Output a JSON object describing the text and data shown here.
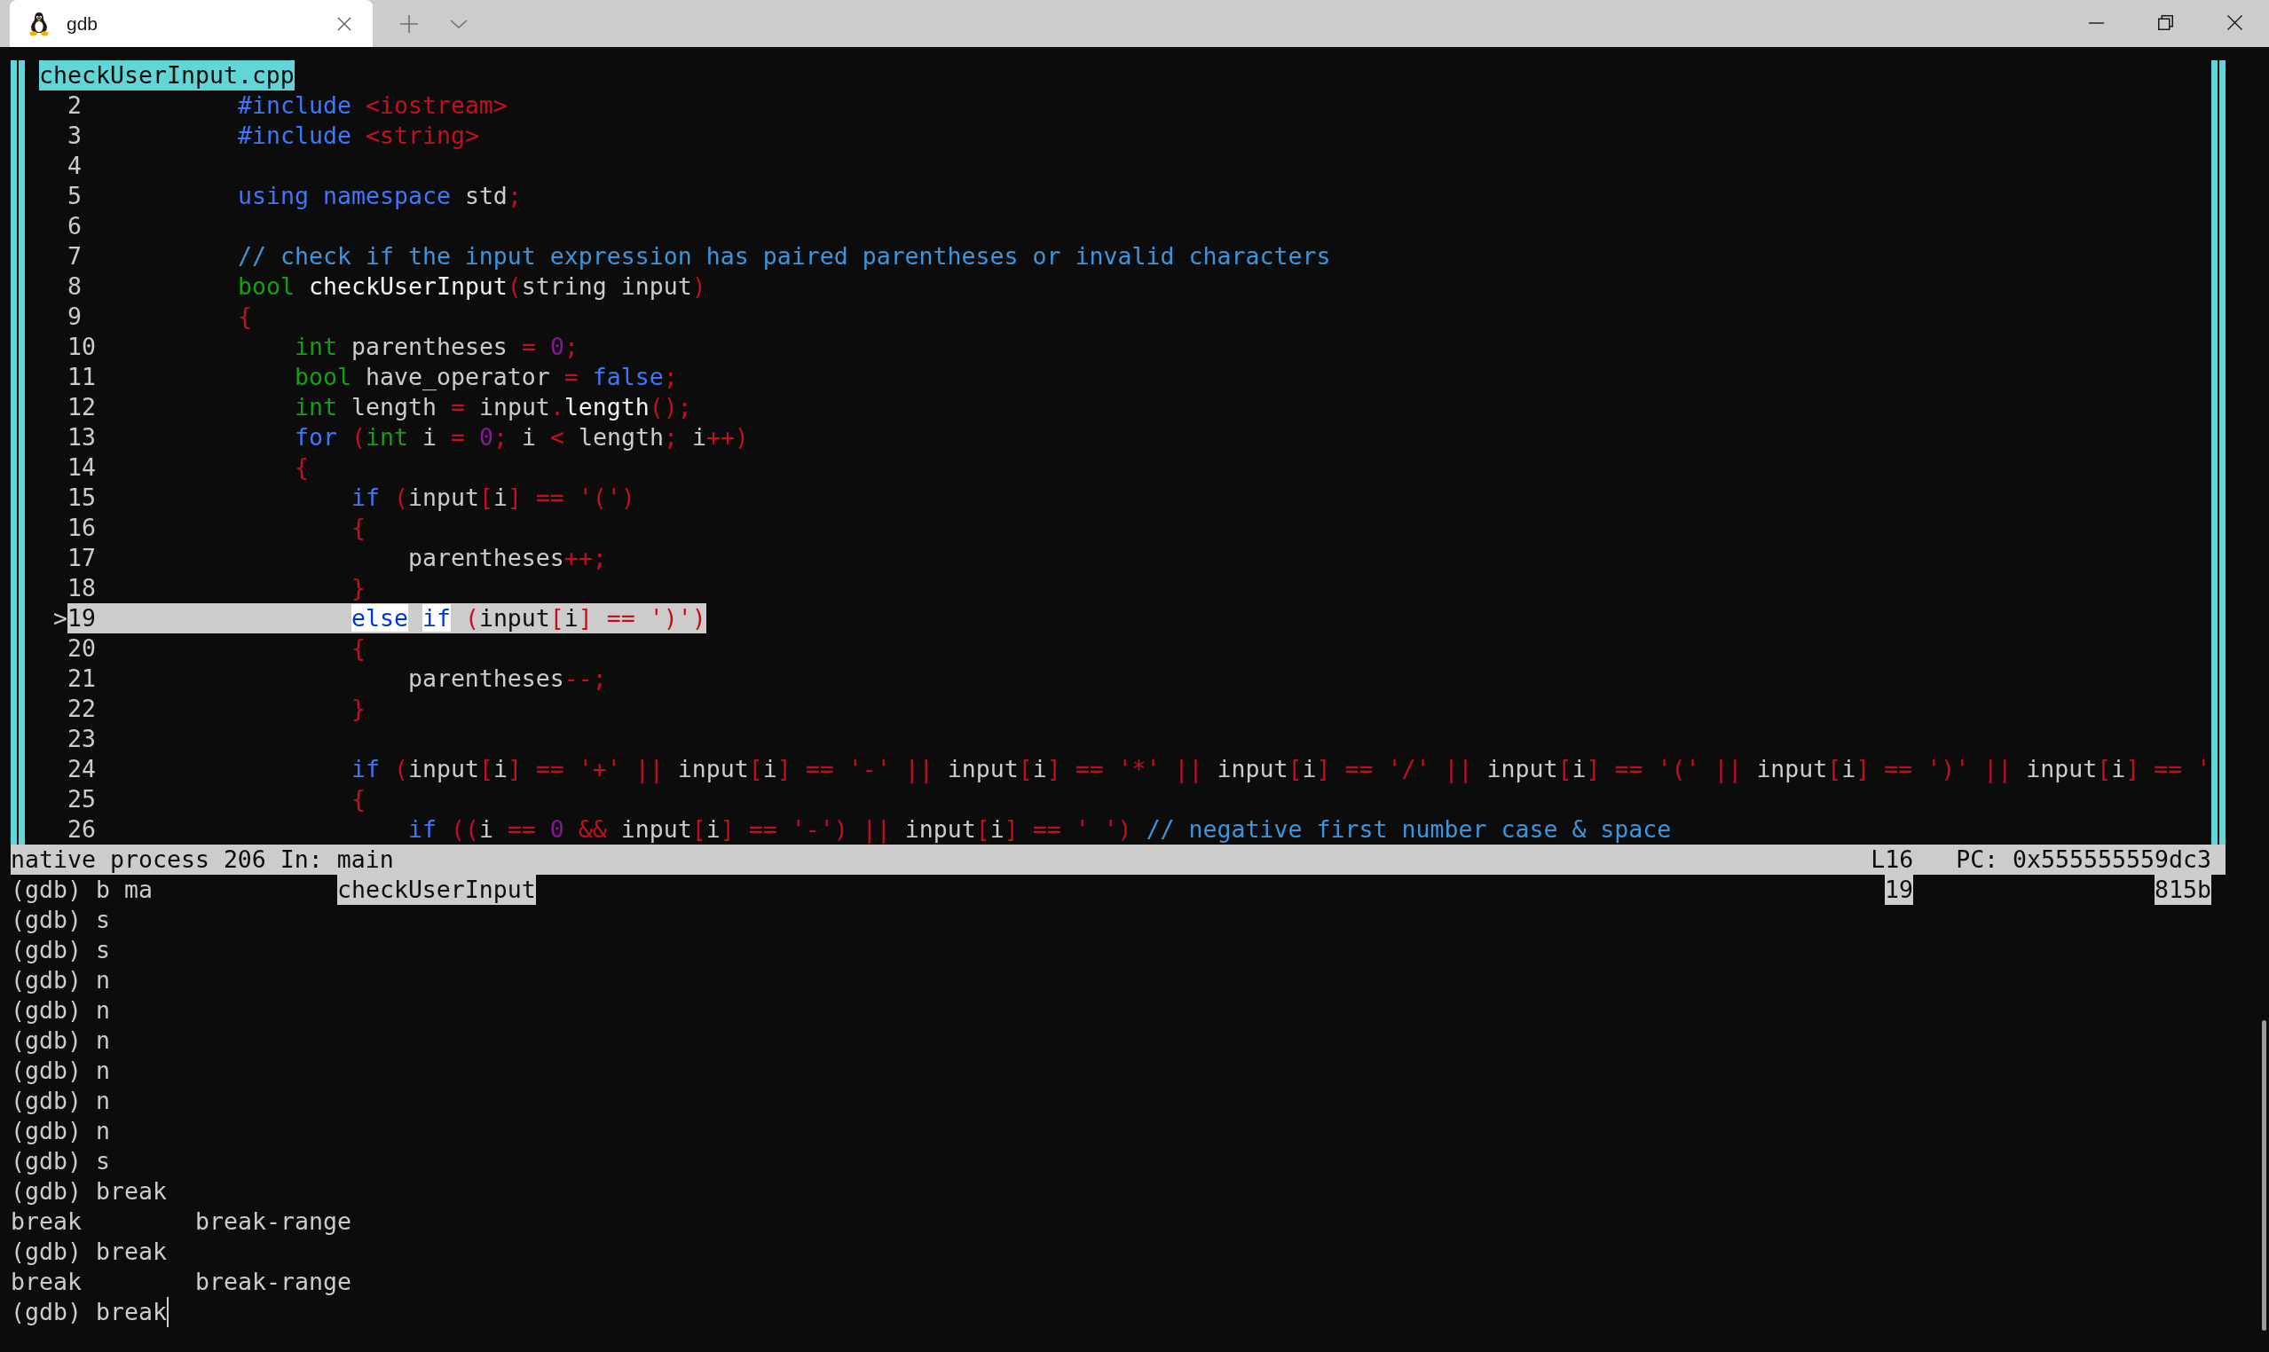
{
  "window": {
    "tabs": [
      {
        "title": "gdb",
        "selected": true
      }
    ]
  },
  "source": {
    "file": "checkUserInput.cpp",
    "lines": [
      {
        "number": "2",
        "current": false,
        "tokens": [
          {
            "kind": "keyword",
            "text": "#include"
          },
          {
            "kind": "string",
            "text": " <iostream>"
          }
        ]
      },
      {
        "number": "3",
        "current": false,
        "tokens": [
          {
            "kind": "keyword",
            "text": "#include"
          },
          {
            "kind": "string",
            "text": " <string>"
          }
        ]
      },
      {
        "number": "4",
        "current": false
      },
      {
        "number": "5",
        "current": false,
        "tokens": [
          {
            "kind": "keyword",
            "text": "using namespace"
          },
          {
            "kind": "plain",
            "text": " std"
          },
          {
            "kind": "punct",
            "text": ";"
          }
        ]
      },
      {
        "number": "6",
        "current": false
      },
      {
        "number": "7",
        "current": false,
        "tokens": [
          {
            "kind": "comment",
            "text": "// check if the input expression has paired parentheses or invalid characters"
          }
        ]
      },
      {
        "number": "8",
        "current": false,
        "tokens": [
          {
            "kind": "type",
            "text": "bool"
          },
          {
            "kind": "function",
            "text": " checkUserInput"
          },
          {
            "kind": "punct",
            "text": "("
          },
          {
            "kind": "plain",
            "text": "string input"
          },
          {
            "kind": "punct",
            "text": ")"
          }
        ]
      },
      {
        "number": "9",
        "current": false,
        "tokens": [
          {
            "kind": "punct",
            "text": "{"
          }
        ]
      },
      {
        "number": "10",
        "current": false,
        "tokens": [
          {
            "kind": "type",
            "text": "    int"
          },
          {
            "kind": "plain",
            "text": " parentheses "
          },
          {
            "kind": "punct",
            "text": "= "
          },
          {
            "kind": "number",
            "text": "0"
          },
          {
            "kind": "punct",
            "text": ";"
          }
        ]
      },
      {
        "number": "11",
        "current": false,
        "tokens": [
          {
            "kind": "type",
            "text": "    bool"
          },
          {
            "kind": "plain",
            "text": " have_operator "
          },
          {
            "kind": "punct",
            "text": "= "
          },
          {
            "kind": "keyword",
            "text": "false"
          },
          {
            "kind": "punct",
            "text": ";"
          }
        ]
      },
      {
        "number": "12",
        "current": false,
        "tokens": [
          {
            "kind": "type",
            "text": "    int"
          },
          {
            "kind": "plain",
            "text": " length "
          },
          {
            "kind": "punct",
            "text": "= "
          },
          {
            "kind": "plain",
            "text": "input"
          },
          {
            "kind": "punct",
            "text": "."
          },
          {
            "kind": "function",
            "text": "length"
          },
          {
            "kind": "punct",
            "text": "();"
          }
        ]
      },
      {
        "number": "13",
        "current": false,
        "tokens": [
          {
            "kind": "keyword",
            "text": "    for"
          },
          {
            "kind": "punct",
            "text": " ("
          },
          {
            "kind": "type",
            "text": "int"
          },
          {
            "kind": "plain",
            "text": " i "
          },
          {
            "kind": "punct",
            "text": "= "
          },
          {
            "kind": "number",
            "text": "0"
          },
          {
            "kind": "punct",
            "text": "; "
          },
          {
            "kind": "plain",
            "text": "i "
          },
          {
            "kind": "punct",
            "text": "< "
          },
          {
            "kind": "plain",
            "text": "length"
          },
          {
            "kind": "punct",
            "text": "; "
          },
          {
            "kind": "plain",
            "text": "i"
          },
          {
            "kind": "punct",
            "text": "++)"
          }
        ]
      },
      {
        "number": "14",
        "current": false,
        "tokens": [
          {
            "kind": "punct",
            "text": "    {"
          }
        ]
      },
      {
        "number": "15",
        "current": false,
        "tokens": [
          {
            "kind": "keyword",
            "text": "        if"
          },
          {
            "kind": "punct",
            "text": " ("
          },
          {
            "kind": "plain",
            "text": "input"
          },
          {
            "kind": "punct",
            "text": "["
          },
          {
            "kind": "plain",
            "text": "i"
          },
          {
            "kind": "punct",
            "text": "] == '(')"
          }
        ]
      },
      {
        "number": "16",
        "current": false,
        "tokens": [
          {
            "kind": "punct",
            "text": "        {"
          }
        ]
      },
      {
        "number": "17",
        "current": false,
        "tokens": [
          {
            "kind": "plain",
            "text": "            parentheses"
          },
          {
            "kind": "punct",
            "text": "++;"
          }
        ]
      },
      {
        "number": "18",
        "current": false,
        "tokens": [
          {
            "kind": "punct",
            "text": "        }"
          }
        ]
      },
      {
        "number": "19",
        "current": true,
        "marker": ">",
        "tokens": [
          {
            "kind": "keyword",
            "text": "        else "
          },
          {
            "kind": "keyword",
            "text": "if"
          },
          {
            "kind": "punct",
            "text": " ("
          },
          {
            "kind": "plain",
            "text": "input"
          },
          {
            "kind": "punct",
            "text": "["
          },
          {
            "kind": "plain",
            "text": "i"
          },
          {
            "kind": "punct",
            "text": "] == ')')"
          }
        ]
      },
      {
        "number": "20",
        "current": false,
        "tokens": [
          {
            "kind": "punct",
            "text": "        {"
          }
        ]
      },
      {
        "number": "21",
        "current": false,
        "tokens": [
          {
            "kind": "plain",
            "text": "            parentheses"
          },
          {
            "kind": "punct",
            "text": "--;"
          }
        ]
      },
      {
        "number": "22",
        "current": false,
        "tokens": [
          {
            "kind": "punct",
            "text": "        }"
          }
        ]
      },
      {
        "number": "23",
        "current": false
      },
      {
        "number": "24",
        "current": false,
        "tokens": [
          {
            "kind": "keyword",
            "text": "        if"
          },
          {
            "kind": "punct",
            "text": " ("
          },
          {
            "kind": "plain",
            "text": "input"
          },
          {
            "kind": "punct",
            "text": "["
          },
          {
            "kind": "plain",
            "text": "i"
          },
          {
            "kind": "punct",
            "text": "] == '+' || "
          },
          {
            "kind": "plain",
            "text": "input"
          },
          {
            "kind": "punct",
            "text": "["
          },
          {
            "kind": "plain",
            "text": "i"
          },
          {
            "kind": "punct",
            "text": "] == '-' || "
          },
          {
            "kind": "plain",
            "text": "input"
          },
          {
            "kind": "punct",
            "text": "["
          },
          {
            "kind": "plain",
            "text": "i"
          },
          {
            "kind": "punct",
            "text": "] == '*' || "
          },
          {
            "kind": "plain",
            "text": "input"
          },
          {
            "kind": "punct",
            "text": "["
          },
          {
            "kind": "plain",
            "text": "i"
          },
          {
            "kind": "punct",
            "text": "] == '/' || "
          },
          {
            "kind": "plain",
            "text": "input"
          },
          {
            "kind": "punct",
            "text": "["
          },
          {
            "kind": "plain",
            "text": "i"
          },
          {
            "kind": "punct",
            "text": "] == '(' || "
          },
          {
            "kind": "plain",
            "text": "input"
          },
          {
            "kind": "punct",
            "text": "["
          },
          {
            "kind": "plain",
            "text": "i"
          },
          {
            "kind": "punct",
            "text": "] == ')' || "
          },
          {
            "kind": "plain",
            "text": "input"
          },
          {
            "kind": "punct",
            "text": "["
          },
          {
            "kind": "plain",
            "text": "i"
          },
          {
            "kind": "punct",
            "text": "] == '"
          }
        ]
      },
      {
        "number": "25",
        "current": false,
        "tokens": [
          {
            "kind": "punct",
            "text": "        {"
          }
        ]
      },
      {
        "number": "26",
        "current": false,
        "tokens": [
          {
            "kind": "keyword",
            "text": "            if"
          },
          {
            "kind": "punct",
            "text": " (("
          },
          {
            "kind": "plain",
            "text": "i "
          },
          {
            "kind": "punct",
            "text": "== "
          },
          {
            "kind": "number",
            "text": "0"
          },
          {
            "kind": "punct",
            "text": " && "
          },
          {
            "kind": "plain",
            "text": "input"
          },
          {
            "kind": "punct",
            "text": "["
          },
          {
            "kind": "plain",
            "text": "i"
          },
          {
            "kind": "punct",
            "text": "] == '-') || "
          },
          {
            "kind": "plain",
            "text": "input"
          },
          {
            "kind": "punct",
            "text": "["
          },
          {
            "kind": "plain",
            "text": "i"
          },
          {
            "kind": "punct",
            "text": "] == ' ') "
          },
          {
            "kind": "comment",
            "text": "// negative first number case & space"
          }
        ]
      }
    ]
  },
  "status_bar": {
    "target": "native process 206 In: main",
    "line": "L16",
    "pc": "PC: 0x555555559dc3"
  },
  "console": {
    "lines": [
      {
        "kind": "command",
        "text": "(gdb) b ma",
        "cursor": false,
        "remnants": [
          "checkUserInput",
          "19",
          "815b"
        ]
      },
      {
        "kind": "command",
        "text": "(gdb) s",
        "cursor": false
      },
      {
        "kind": "command",
        "text": "(gdb) s",
        "cursor": false
      },
      {
        "kind": "command",
        "text": "(gdb) n",
        "cursor": false
      },
      {
        "kind": "command",
        "text": "(gdb) n",
        "cursor": false
      },
      {
        "kind": "command",
        "text": "(gdb) n",
        "cursor": false
      },
      {
        "kind": "command",
        "text": "(gdb) n",
        "cursor": false
      },
      {
        "kind": "command",
        "text": "(gdb) n",
        "cursor": false
      },
      {
        "kind": "command",
        "text": "(gdb) n",
        "cursor": false
      },
      {
        "kind": "command",
        "text": "(gdb) s",
        "cursor": false
      },
      {
        "kind": "command",
        "text": "(gdb) break",
        "cursor": false
      },
      {
        "kind": "completions",
        "items": [
          "break",
          "break-range"
        ]
      },
      {
        "kind": "command",
        "text": "(gdb) break",
        "cursor": false
      },
      {
        "kind": "completions",
        "items": [
          "break",
          "break-range"
        ]
      },
      {
        "kind": "command",
        "text": "(gdb) break",
        "cursor": true
      }
    ]
  }
}
